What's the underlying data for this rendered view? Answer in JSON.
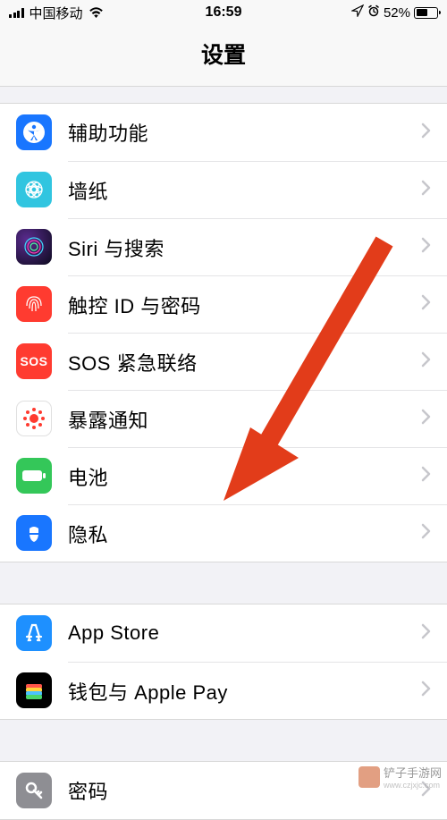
{
  "status": {
    "carrier": "中国移动",
    "time": "16:59",
    "battery_pct": "52%"
  },
  "header": {
    "title": "设置"
  },
  "groups": [
    {
      "items": [
        {
          "id": "accessibility",
          "label": "辅助功能",
          "icon": "accessibility-icon",
          "color": "#1976ff"
        },
        {
          "id": "wallpaper",
          "label": "墙纸",
          "icon": "wallpaper-icon",
          "color": "#31c5e0"
        },
        {
          "id": "siri",
          "label": "Siri 与搜索",
          "icon": "siri-icon",
          "color": "#000"
        },
        {
          "id": "touchid",
          "label": "触控 ID 与密码",
          "icon": "touchid-icon",
          "color": "#ff3b30"
        },
        {
          "id": "sos",
          "label": "SOS 紧急联络",
          "icon": "sos-icon",
          "color": "#ff3b30",
          "icon_text": "SOS"
        },
        {
          "id": "exposure",
          "label": "暴露通知",
          "icon": "exposure-icon",
          "color": "#ffffff"
        },
        {
          "id": "battery",
          "label": "电池",
          "icon": "battery-icon",
          "color": "#34c759"
        },
        {
          "id": "privacy",
          "label": "隐私",
          "icon": "privacy-icon",
          "color": "#1976ff"
        }
      ]
    },
    {
      "items": [
        {
          "id": "appstore",
          "label": "App Store",
          "icon": "appstore-icon",
          "color": "#1e90ff"
        },
        {
          "id": "wallet",
          "label": "钱包与 Apple Pay",
          "icon": "wallet-icon",
          "color": "#000"
        }
      ]
    },
    {
      "items": [
        {
          "id": "passwords",
          "label": "密码",
          "icon": "key-icon",
          "color": "#8e8e93"
        }
      ]
    }
  ],
  "watermark": {
    "brand": "铲子手游网",
    "url": "www.czjxjc.com"
  },
  "annotation": {
    "arrow_color": "#e23c1a",
    "points_to": "privacy"
  }
}
